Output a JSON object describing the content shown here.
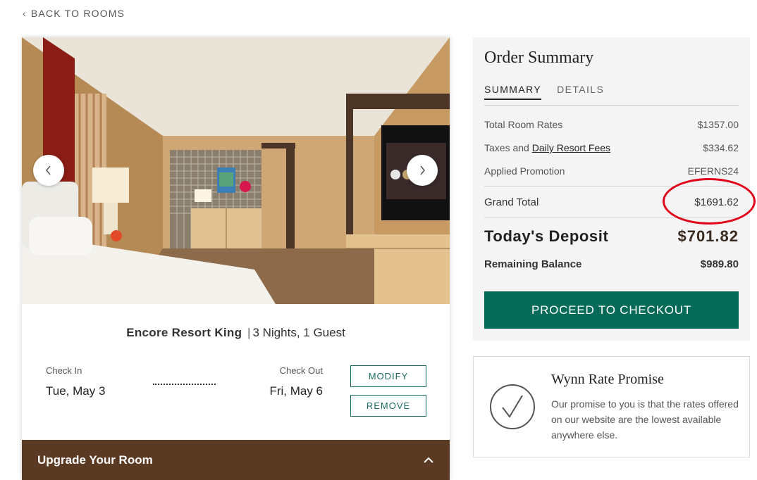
{
  "nav": {
    "back_label": "BACK TO ROOMS"
  },
  "room": {
    "name": "Encore Resort King",
    "separator": "|",
    "details": "3 Nights, 1 Guest",
    "check_in_label": "Check In",
    "check_in_date": "Tue, May 3",
    "check_out_label": "Check Out",
    "check_out_date": "Fri, May 6",
    "modify_label": "MODIFY",
    "remove_label": "REMOVE",
    "upgrade_label": "Upgrade Your Room"
  },
  "summary": {
    "title": "Order Summary",
    "tabs": [
      {
        "label": "SUMMARY",
        "active": true
      },
      {
        "label": "DETAILS",
        "active": false
      }
    ],
    "total_room_rates_label": "Total Room Rates",
    "total_room_rates_value": "$1357.00",
    "taxes_prefix": "Taxes and",
    "taxes_link": "Daily Resort Fees",
    "taxes_value": "$334.62",
    "promotion_label": "Applied Promotion",
    "promotion_value": "EFERNS24",
    "grand_total_label": "Grand Total",
    "grand_total_value": "$1691.62",
    "deposit_label": "Today's Deposit",
    "deposit_value": "$701.82",
    "balance_label": "Remaining Balance",
    "balance_value": "$989.80",
    "checkout_label": "PROCEED TO CHECKOUT"
  },
  "promise": {
    "title": "Wynn Rate Promise",
    "text": "Our promise to you is that the rates offered on our website are the lowest available anywhere else."
  },
  "colors": {
    "accent_green": "#066a58",
    "upgrade_brown": "#5b3a23",
    "highlight_red": "#e0001a"
  }
}
